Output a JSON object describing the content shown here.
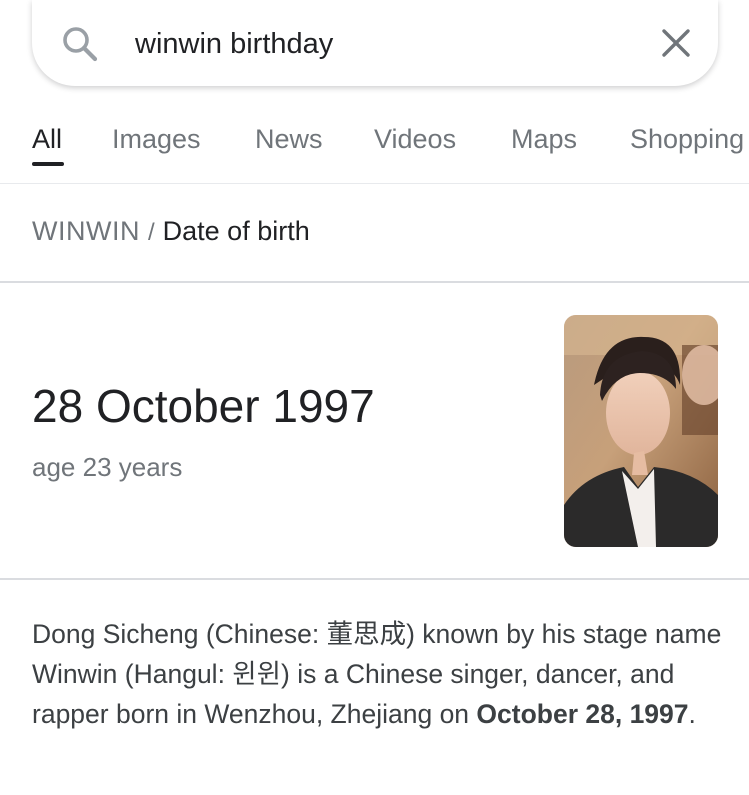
{
  "search": {
    "query": "winwin birthday",
    "search_icon": "search-icon",
    "clear_icon": "close-icon"
  },
  "tabs": [
    {
      "label": "All",
      "active": true
    },
    {
      "label": "Images",
      "active": false
    },
    {
      "label": "News",
      "active": false
    },
    {
      "label": "Videos",
      "active": false
    },
    {
      "label": "Maps",
      "active": false
    },
    {
      "label": "Shopping",
      "active": false
    }
  ],
  "breadcrumb": {
    "entity": "WINWIN",
    "separator": "/",
    "attribute": "Date of birth"
  },
  "answer": {
    "date": "28 October 1997",
    "age": "age 23 years"
  },
  "description": {
    "text": "Dong Sicheng (Chinese: 董思成) known by his stage name Winwin (Hangul: 윈윈) is a Chinese singer, dancer, and rapper born in Wenzhou, Zhejiang on ",
    "bold": "October 28, 1997",
    "end": "."
  },
  "colors": {
    "text_primary": "#202124",
    "text_secondary": "#70757a",
    "divider": "#dadce0"
  }
}
